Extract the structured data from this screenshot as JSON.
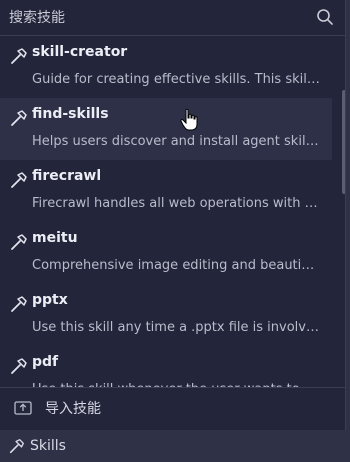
{
  "search": {
    "placeholder": "搜索技能"
  },
  "skills": [
    {
      "name": "skill-creator",
      "description": "Guide for creating effective skills. This skill should be used when users want to create a new skill",
      "hovered": false
    },
    {
      "name": "find-skills",
      "description": "Helps users discover and install agent skills when they ask questions",
      "hovered": true
    },
    {
      "name": "firecrawl",
      "description": "Firecrawl handles all web operations with superior accuracy",
      "hovered": false
    },
    {
      "name": "meitu",
      "description": "Comprehensive image editing and beautification tools",
      "hovered": false
    },
    {
      "name": "pptx",
      "description": "Use this skill any time a .pptx file is involved in any way",
      "hovered": false
    },
    {
      "name": "pdf",
      "description": "Use this skill whenever the user wants to do anything with PDF files",
      "hovered": false
    }
  ],
  "import": {
    "label": "导入技能",
    "icon": "upload-icon"
  },
  "bottom_bar": {
    "skills_label": "Skills",
    "icon": "hammer-icon"
  },
  "colors": {
    "panel_bg": "#23253a",
    "page_bg": "#2f3247",
    "hover_bg": "#2d3047",
    "text_primary": "#eceef5",
    "text_secondary": "#b9bccb"
  }
}
